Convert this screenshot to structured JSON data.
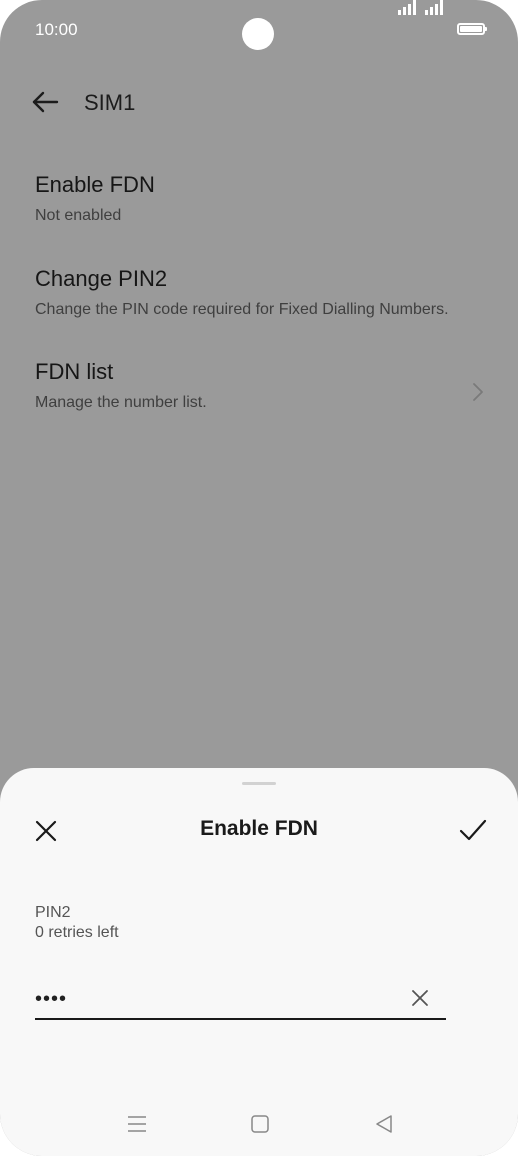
{
  "status_bar": {
    "time": "10:00",
    "icons": [
      "signal-icon",
      "signal-icon",
      "battery-icon"
    ]
  },
  "header": {
    "title": "SIM1",
    "back_icon": "arrow-left-icon"
  },
  "settings": {
    "items": [
      {
        "title": "Enable FDN",
        "subtitle": "Not enabled"
      },
      {
        "title": "Change PIN2",
        "subtitle": "Change the PIN code required for Fixed Dialling Numbers."
      },
      {
        "title": "FDN list",
        "subtitle": "Manage the number list.",
        "icon": "chevron-right-icon"
      }
    ]
  },
  "dialog": {
    "title": "Enable FDN",
    "close_icon": "close-icon",
    "confirm_icon": "checkmark-icon",
    "field_label": "PIN2",
    "field_hint": "0 retries left",
    "pin_value": "••••",
    "clear_icon": "clear-icon"
  },
  "nav_bar": {
    "icons": [
      "menu-icon",
      "home-icon",
      "back-icon"
    ]
  },
  "colors": {
    "dim_background": "#9a9a9a",
    "sheet_background": "#f8f8f8",
    "text_primary": "#1a1a1a"
  }
}
